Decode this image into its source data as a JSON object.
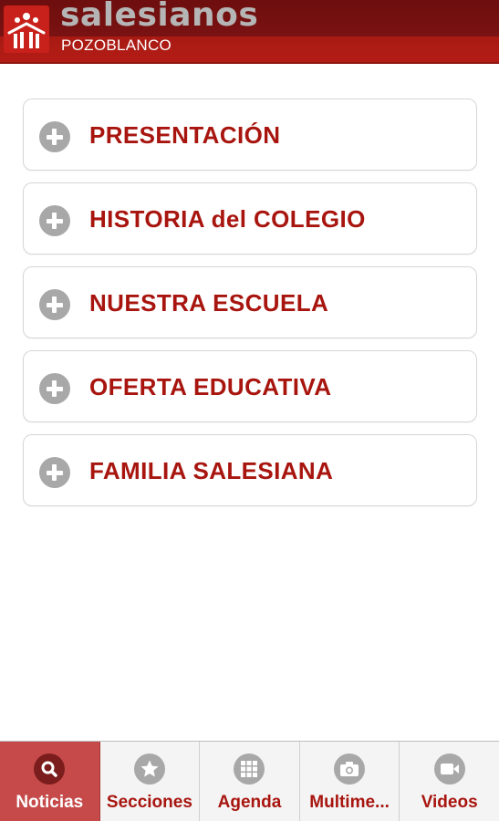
{
  "header": {
    "brand": "salesianos",
    "subtitle": "POZOBLANCO",
    "logo_icon": "salesianos-logo-icon"
  },
  "menu": {
    "items": [
      {
        "label": "PRESENTACIÓN",
        "icon": "plus-circle-icon"
      },
      {
        "label": "HISTORIA del COLEGIO",
        "icon": "plus-circle-icon"
      },
      {
        "label": "NUESTRA ESCUELA",
        "icon": "plus-circle-icon"
      },
      {
        "label": "OFERTA EDUCATIVA",
        "icon": "plus-circle-icon"
      },
      {
        "label": "FAMILIA SALESIANA",
        "icon": "plus-circle-icon"
      }
    ]
  },
  "bottom_nav": {
    "active": "Noticias",
    "items": [
      {
        "label": "Noticias",
        "icon": "search-icon"
      },
      {
        "label": "Secciones",
        "icon": "star-icon"
      },
      {
        "label": "Agenda",
        "icon": "grid-icon"
      },
      {
        "label": "Multime...",
        "icon": "camera-icon"
      },
      {
        "label": "Videos",
        "icon": "video-camera-icon"
      }
    ]
  },
  "colors": {
    "brand_red": "#a8150f",
    "header_dark": "#6e0e0e",
    "active_tab": "#c64a4a",
    "icon_gray": "#a8a8a8"
  }
}
